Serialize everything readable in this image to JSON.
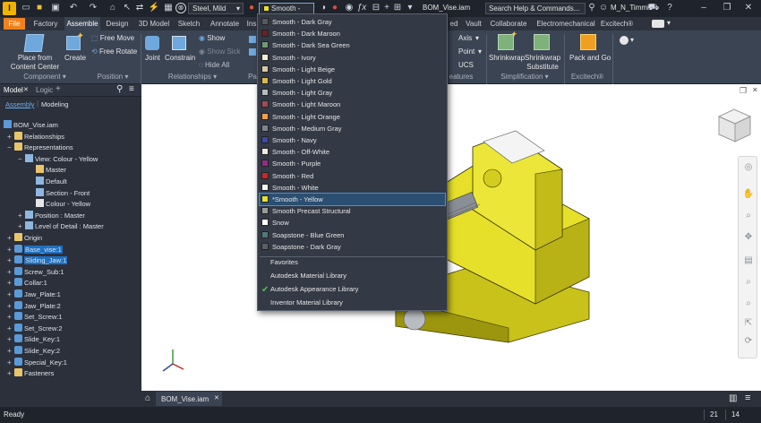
{
  "titlebar": {
    "file_tab": "File",
    "material": "Steel, Mild",
    "appearance": "Smooth - Yellow",
    "doc_title": "BOM_Vise.iam",
    "search_placeholder": "Search Help & Commands...",
    "user": "M_N_Timmis"
  },
  "tabs": [
    "File",
    "Factory",
    "Assemble",
    "Design",
    "3D Model",
    "Sketch",
    "Annotate",
    "Ins",
    "ed",
    "Vault",
    "Collaborate",
    "Electromechanical",
    "Excitech®"
  ],
  "ribbon": {
    "place_from_content_center": "Place from Content Center",
    "create": "Create",
    "free_move": "Free Move",
    "free_rotate": "Free Rotate",
    "joint": "Joint",
    "constrain": "Constrain",
    "show": "Show",
    "show_sick": "Show Sick",
    "hide_all": "Hide All",
    "axis": "Axis",
    "point": "Point",
    "ucs": "UCS",
    "shrinkwrap": "Shrinkwrap",
    "shrinkwrap_substitute": "Shrinkwrap Substitute",
    "pack_and_go": "Pack and Go",
    "groups": {
      "component": "Component",
      "position": "Position",
      "relationships": "Relationships",
      "pa": "Pa",
      "features": "eatures",
      "simplification": "Simplification",
      "excitech": "Excitech®"
    }
  },
  "browser": {
    "tab_model": "Model",
    "tab_logic": "Logic",
    "sub_assembly": "Assembly",
    "sub_modeling": "Modeling",
    "nodes": [
      "BOM_Vise.iam",
      "Relationships",
      "Representations",
      "View: Colour - Yellow",
      "Master",
      "Default",
      "Section - Front",
      "Colour - Yellow",
      "Position : Master",
      "Level of Detail : Master",
      "Origin",
      "Base_vise:1",
      "Sliding_Jaw:1",
      "Screw_Sub:1",
      "Collar:1",
      "Jaw_Plate:1",
      "Jaw_Plate:2",
      "Set_Screw:1",
      "Set_Screw:2",
      "Slide_Key:1",
      "Slide_Key:2",
      "Special_Key:1",
      "Fasteners"
    ]
  },
  "menu": {
    "items": [
      {
        "label": "Smooth - Dark Gray",
        "color": "#555a60"
      },
      {
        "label": "Smooth - Dark Maroon",
        "color": "#6b1f2a"
      },
      {
        "label": "Smooth - Dark Sea Green",
        "color": "#6f9a78"
      },
      {
        "label": "Smooth - Ivory",
        "color": "#f3edd3"
      },
      {
        "label": "Smooth - Light Beige",
        "color": "#d9c9a5"
      },
      {
        "label": "Smooth - Light Gold",
        "color": "#d9b94e"
      },
      {
        "label": "Smooth - Light Gray",
        "color": "#b8bcc2"
      },
      {
        "label": "Smooth - Light Maroon",
        "color": "#a34b57"
      },
      {
        "label": "Smooth - Light Orange",
        "color": "#f0a049"
      },
      {
        "label": "Smooth - Medium Gray",
        "color": "#80858c"
      },
      {
        "label": "Smooth - Navy",
        "color": "#3a4aa8"
      },
      {
        "label": "Smooth - Off-White",
        "color": "#eeeae0"
      },
      {
        "label": "Smooth - Purple",
        "color": "#8d2f8a"
      },
      {
        "label": "Smooth - Red",
        "color": "#c62828"
      },
      {
        "label": "Smooth - White",
        "color": "#f7f7f7"
      },
      {
        "label": "*Smooth - Yellow",
        "color": "#e7e22b"
      },
      {
        "label": "Smooth Precast Structural",
        "color": "#9a9a98"
      },
      {
        "label": "Snow",
        "color": "#ffffff"
      },
      {
        "label": "Soapstone - Blue Green",
        "color": "#4f7a78"
      },
      {
        "label": "Soapstone - Dark Gray",
        "color": "#5c5f62"
      }
    ],
    "libraries": [
      "Favorites",
      "Autodesk Material Library",
      "Autodesk Appearance Library",
      "Inventor Material Library"
    ]
  },
  "doc_tab": "BOM_Vise.iam",
  "status": {
    "text": "Ready",
    "n1": "21",
    "n2": "14"
  }
}
